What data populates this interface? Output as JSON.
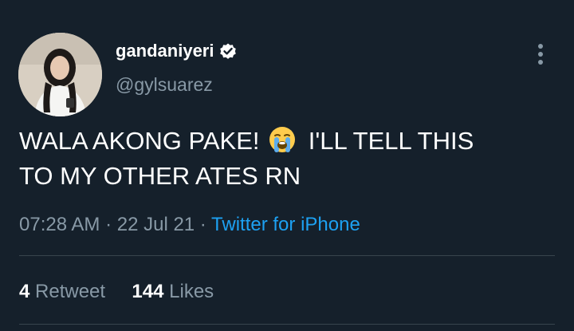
{
  "tweet": {
    "display_name": "gandaniyeri",
    "handle": "@gylsuarez",
    "text_line1": "WALA AKONG PAKE!",
    "emoji_name": "loudly-crying-face-icon",
    "text_line1b": "I'LL TELL THIS",
    "text_line2": "TO MY OTHER ATES RN",
    "time": "07:28 AM",
    "sep1": " · ",
    "date": "22 Jul 21",
    "sep2": " · ",
    "source": "Twitter for iPhone",
    "retweets_count": "4",
    "retweets_label": "Retweet",
    "likes_count": "144",
    "likes_label": "Likes"
  },
  "colors": {
    "background": "#15202b",
    "text_primary": "#ffffff",
    "text_secondary": "#8899a6",
    "link": "#1da1f2",
    "divider": "#38444d"
  }
}
